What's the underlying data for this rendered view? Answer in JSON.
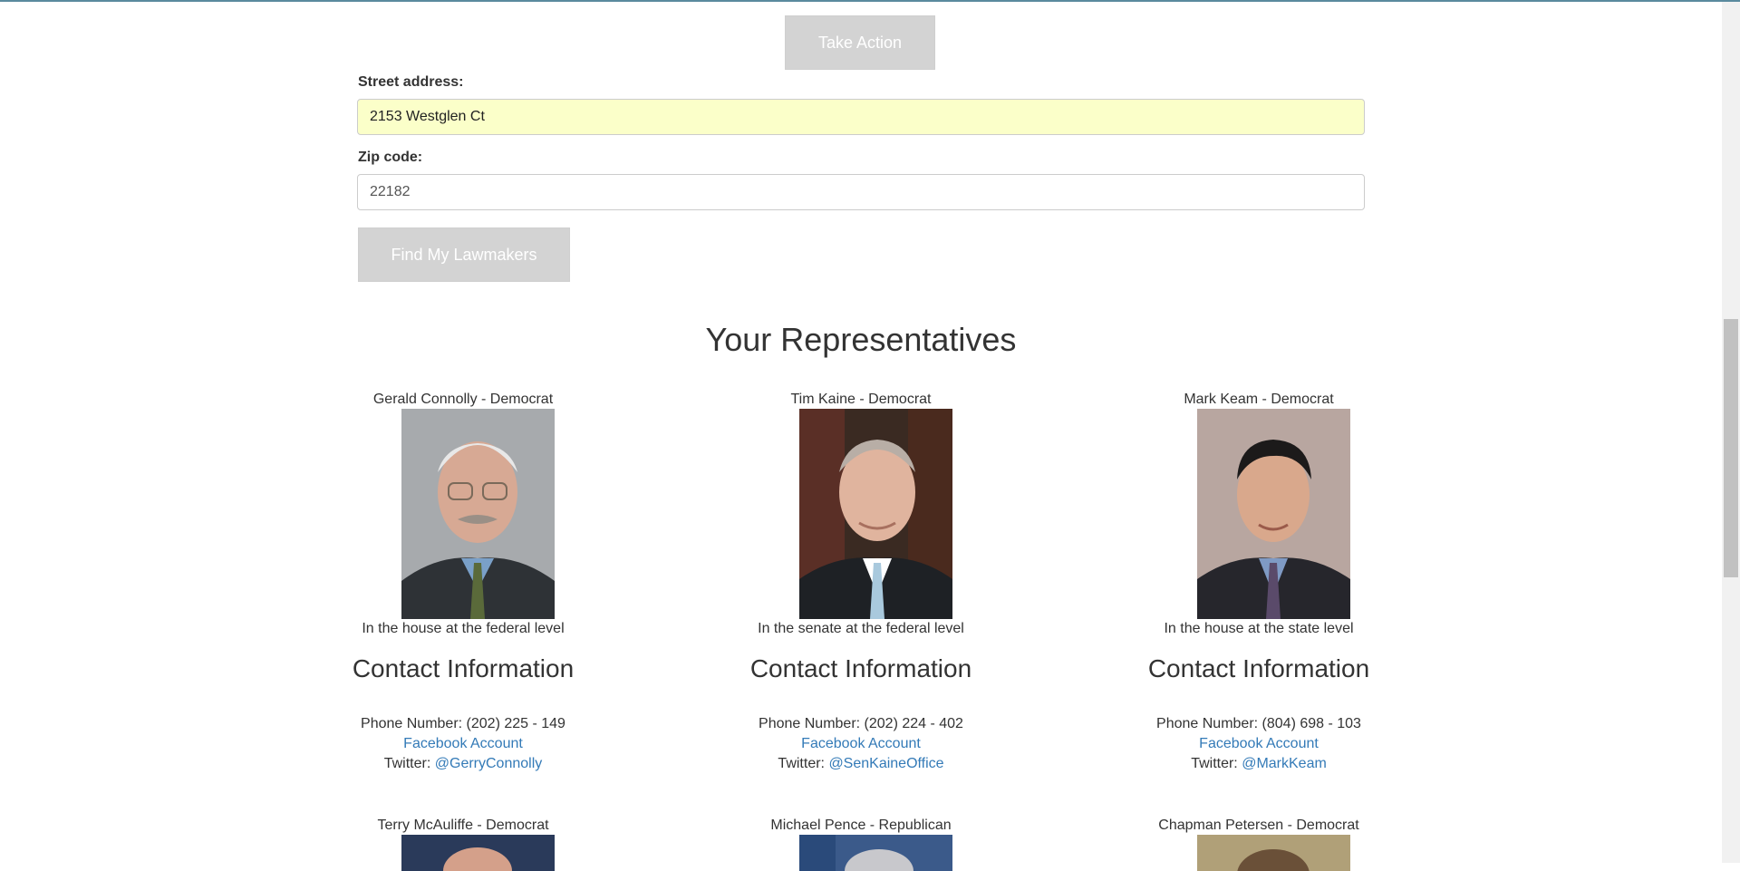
{
  "buttons": {
    "take_action": "Take Action",
    "find_lawmakers": "Find My Lawmakers"
  },
  "form": {
    "street_label": "Street address:",
    "street_value": "2153 Westglen Ct",
    "zip_label": "Zip code:",
    "zip_value": "22182"
  },
  "section_title": "Your Representatives",
  "representatives": [
    {
      "name": "Gerald Connolly - Democrat",
      "level": "In the house at the federal level",
      "contact_title": "Contact Information",
      "phone_label": "Phone Number:",
      "phone": "(202) 225 - 149",
      "facebook": "Facebook Account",
      "twitter_label": "Twitter:",
      "twitter": "@GerryConnolly"
    },
    {
      "name": "Tim Kaine - Democrat",
      "level": "In the senate at the federal level",
      "contact_title": "Contact Information",
      "phone_label": "Phone Number:",
      "phone": "(202) 224 - 402",
      "facebook": "Facebook Account",
      "twitter_label": "Twitter:",
      "twitter": "@SenKaineOffice"
    },
    {
      "name": "Mark Keam - Democrat",
      "level": "In the house at the state level",
      "contact_title": "Contact Information",
      "phone_label": "Phone Number:",
      "phone": "(804) 698 - 103",
      "facebook": "Facebook Account",
      "twitter_label": "Twitter:",
      "twitter": "@MarkKeam"
    },
    {
      "name": "Terry McAuliffe - Democrat"
    },
    {
      "name": "Michael Pence - Republican"
    },
    {
      "name": "Chapman Petersen - Democrat"
    }
  ],
  "colors": {
    "link": "#337ab7",
    "button_bg": "#d3d3d3",
    "autofill_bg": "#fbffc9"
  }
}
